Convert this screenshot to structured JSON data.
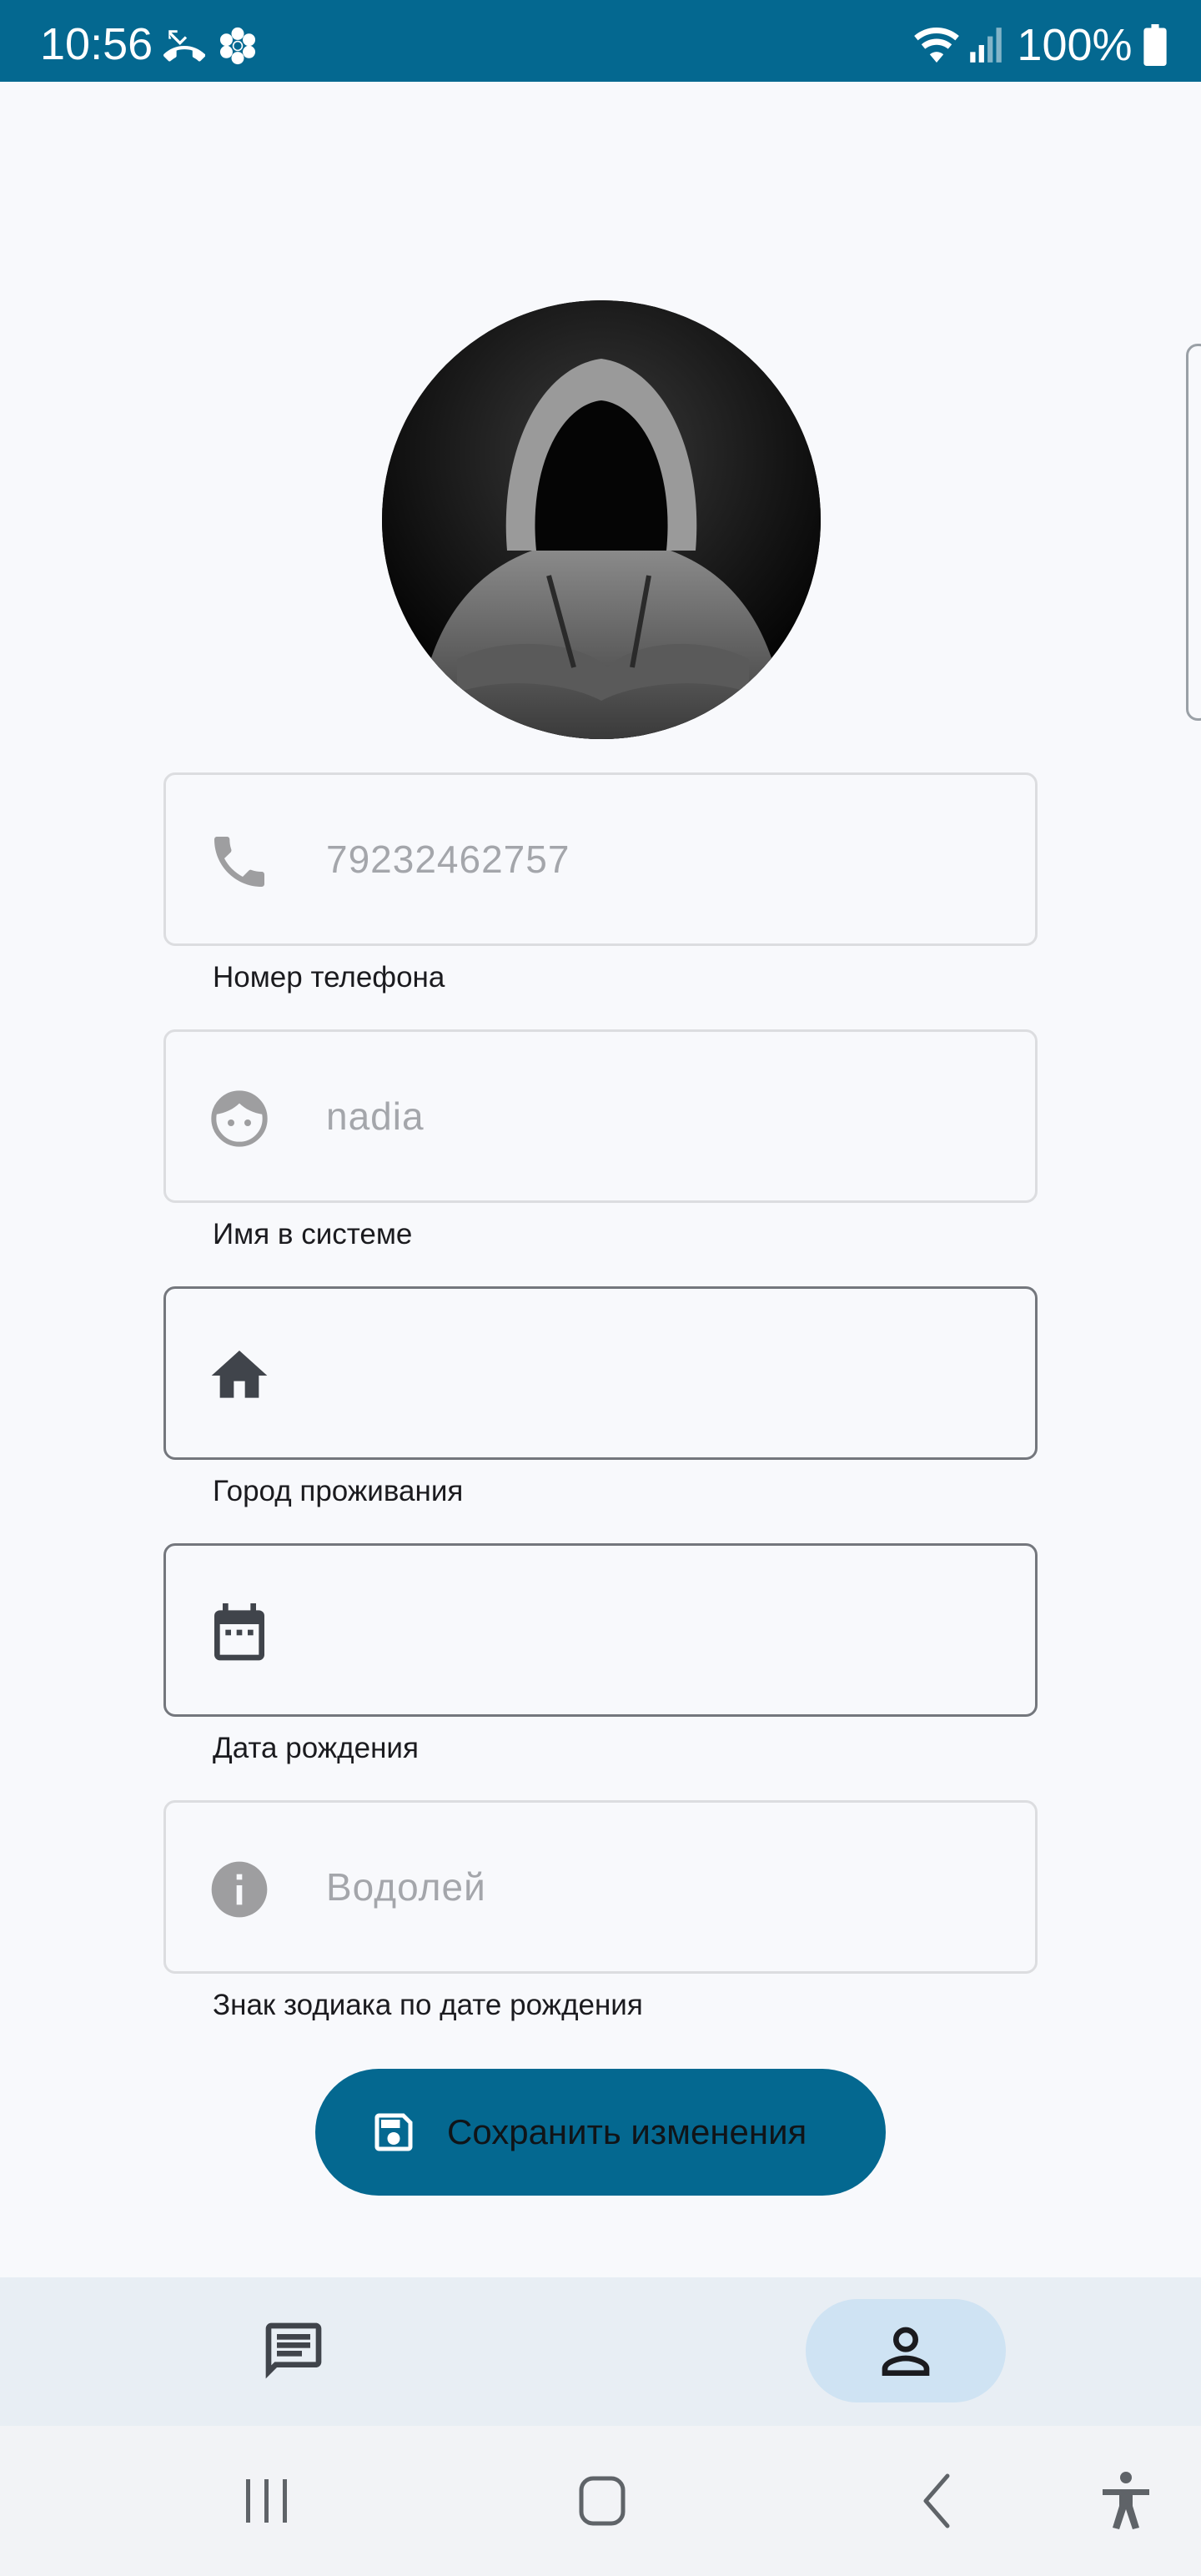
{
  "status_bar": {
    "time": "10:56",
    "battery": "100%",
    "background": "#046890",
    "icons": [
      "missed-call-icon",
      "flower-icon",
      "wifi-icon",
      "signal-icon",
      "battery-icon"
    ]
  },
  "profile": {
    "avatar_icon": "hooded-figure-avatar"
  },
  "fields": [
    {
      "icon": "phone-icon",
      "value": "79232462757",
      "label": "Номер телефона"
    },
    {
      "icon": "face-icon",
      "value": "nadia",
      "label": "Имя в системе"
    },
    {
      "icon": "home-icon",
      "value": "",
      "label": "Город проживания"
    },
    {
      "icon": "calendar-icon",
      "value": "",
      "label": "Дата рождения"
    },
    {
      "icon": "info-icon",
      "value": "Водолей",
      "label": "Знак зодиака по дате рождения"
    }
  ],
  "save_button": {
    "label": "Сохранить изменения",
    "icon": "save-icon",
    "color": "#046890"
  },
  "bottom_nav": {
    "items": [
      {
        "icon": "chat-icon",
        "selected": false
      },
      {
        "icon": "person-icon",
        "selected": true
      }
    ]
  },
  "system_nav": {
    "icons": [
      "recents-icon",
      "home-icon",
      "back-icon",
      "accessibility-icon"
    ]
  }
}
